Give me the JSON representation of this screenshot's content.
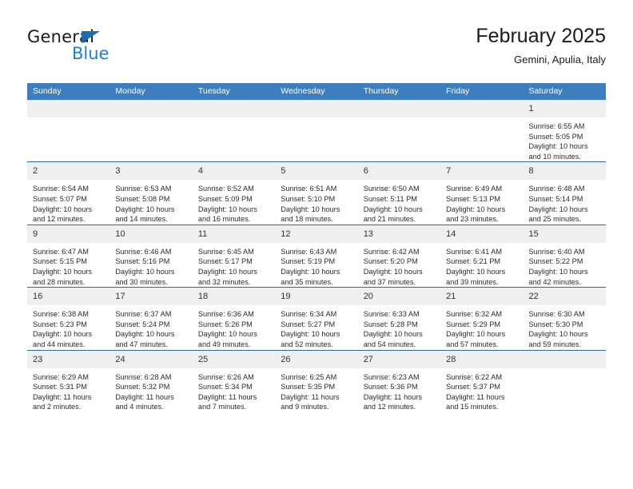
{
  "brand": {
    "name_part1": "General",
    "name_part2": "Blue",
    "triangle_color": "#1d6cb3",
    "blue_color": "#1f7fd4"
  },
  "header": {
    "title": "February 2025",
    "subtitle": "Gemini, Apulia, Italy"
  },
  "theme": {
    "header_row_bg": "#3d7ebf",
    "header_row_text": "#ffffff",
    "daynum_bg": "#efefef",
    "row_border": "#2e6da4"
  },
  "weekdays": [
    "Sunday",
    "Monday",
    "Tuesday",
    "Wednesday",
    "Thursday",
    "Friday",
    "Saturday"
  ],
  "weeks": [
    [
      {
        "day": "",
        "empty": true
      },
      {
        "day": "",
        "empty": true
      },
      {
        "day": "",
        "empty": true
      },
      {
        "day": "",
        "empty": true
      },
      {
        "day": "",
        "empty": true
      },
      {
        "day": "",
        "empty": true
      },
      {
        "day": "1",
        "sunrise": "Sunrise: 6:55 AM",
        "sunset": "Sunset: 5:05 PM",
        "daylight": "Daylight: 10 hours and 10 minutes."
      }
    ],
    [
      {
        "day": "2",
        "sunrise": "Sunrise: 6:54 AM",
        "sunset": "Sunset: 5:07 PM",
        "daylight": "Daylight: 10 hours and 12 minutes."
      },
      {
        "day": "3",
        "sunrise": "Sunrise: 6:53 AM",
        "sunset": "Sunset: 5:08 PM",
        "daylight": "Daylight: 10 hours and 14 minutes."
      },
      {
        "day": "4",
        "sunrise": "Sunrise: 6:52 AM",
        "sunset": "Sunset: 5:09 PM",
        "daylight": "Daylight: 10 hours and 16 minutes."
      },
      {
        "day": "5",
        "sunrise": "Sunrise: 6:51 AM",
        "sunset": "Sunset: 5:10 PM",
        "daylight": "Daylight: 10 hours and 18 minutes."
      },
      {
        "day": "6",
        "sunrise": "Sunrise: 6:50 AM",
        "sunset": "Sunset: 5:11 PM",
        "daylight": "Daylight: 10 hours and 21 minutes."
      },
      {
        "day": "7",
        "sunrise": "Sunrise: 6:49 AM",
        "sunset": "Sunset: 5:13 PM",
        "daylight": "Daylight: 10 hours and 23 minutes."
      },
      {
        "day": "8",
        "sunrise": "Sunrise: 6:48 AM",
        "sunset": "Sunset: 5:14 PM",
        "daylight": "Daylight: 10 hours and 25 minutes."
      }
    ],
    [
      {
        "day": "9",
        "sunrise": "Sunrise: 6:47 AM",
        "sunset": "Sunset: 5:15 PM",
        "daylight": "Daylight: 10 hours and 28 minutes."
      },
      {
        "day": "10",
        "sunrise": "Sunrise: 6:46 AM",
        "sunset": "Sunset: 5:16 PM",
        "daylight": "Daylight: 10 hours and 30 minutes."
      },
      {
        "day": "11",
        "sunrise": "Sunrise: 6:45 AM",
        "sunset": "Sunset: 5:17 PM",
        "daylight": "Daylight: 10 hours and 32 minutes."
      },
      {
        "day": "12",
        "sunrise": "Sunrise: 6:43 AM",
        "sunset": "Sunset: 5:19 PM",
        "daylight": "Daylight: 10 hours and 35 minutes."
      },
      {
        "day": "13",
        "sunrise": "Sunrise: 6:42 AM",
        "sunset": "Sunset: 5:20 PM",
        "daylight": "Daylight: 10 hours and 37 minutes."
      },
      {
        "day": "14",
        "sunrise": "Sunrise: 6:41 AM",
        "sunset": "Sunset: 5:21 PM",
        "daylight": "Daylight: 10 hours and 39 minutes."
      },
      {
        "day": "15",
        "sunrise": "Sunrise: 6:40 AM",
        "sunset": "Sunset: 5:22 PM",
        "daylight": "Daylight: 10 hours and 42 minutes."
      }
    ],
    [
      {
        "day": "16",
        "sunrise": "Sunrise: 6:38 AM",
        "sunset": "Sunset: 5:23 PM",
        "daylight": "Daylight: 10 hours and 44 minutes."
      },
      {
        "day": "17",
        "sunrise": "Sunrise: 6:37 AM",
        "sunset": "Sunset: 5:24 PM",
        "daylight": "Daylight: 10 hours and 47 minutes."
      },
      {
        "day": "18",
        "sunrise": "Sunrise: 6:36 AM",
        "sunset": "Sunset: 5:26 PM",
        "daylight": "Daylight: 10 hours and 49 minutes."
      },
      {
        "day": "19",
        "sunrise": "Sunrise: 6:34 AM",
        "sunset": "Sunset: 5:27 PM",
        "daylight": "Daylight: 10 hours and 52 minutes."
      },
      {
        "day": "20",
        "sunrise": "Sunrise: 6:33 AM",
        "sunset": "Sunset: 5:28 PM",
        "daylight": "Daylight: 10 hours and 54 minutes."
      },
      {
        "day": "21",
        "sunrise": "Sunrise: 6:32 AM",
        "sunset": "Sunset: 5:29 PM",
        "daylight": "Daylight: 10 hours and 57 minutes."
      },
      {
        "day": "22",
        "sunrise": "Sunrise: 6:30 AM",
        "sunset": "Sunset: 5:30 PM",
        "daylight": "Daylight: 10 hours and 59 minutes."
      }
    ],
    [
      {
        "day": "23",
        "sunrise": "Sunrise: 6:29 AM",
        "sunset": "Sunset: 5:31 PM",
        "daylight": "Daylight: 11 hours and 2 minutes."
      },
      {
        "day": "24",
        "sunrise": "Sunrise: 6:28 AM",
        "sunset": "Sunset: 5:32 PM",
        "daylight": "Daylight: 11 hours and 4 minutes."
      },
      {
        "day": "25",
        "sunrise": "Sunrise: 6:26 AM",
        "sunset": "Sunset: 5:34 PM",
        "daylight": "Daylight: 11 hours and 7 minutes."
      },
      {
        "day": "26",
        "sunrise": "Sunrise: 6:25 AM",
        "sunset": "Sunset: 5:35 PM",
        "daylight": "Daylight: 11 hours and 9 minutes."
      },
      {
        "day": "27",
        "sunrise": "Sunrise: 6:23 AM",
        "sunset": "Sunset: 5:36 PM",
        "daylight": "Daylight: 11 hours and 12 minutes."
      },
      {
        "day": "28",
        "sunrise": "Sunrise: 6:22 AM",
        "sunset": "Sunset: 5:37 PM",
        "daylight": "Daylight: 11 hours and 15 minutes."
      },
      {
        "day": "",
        "empty": true
      }
    ]
  ]
}
